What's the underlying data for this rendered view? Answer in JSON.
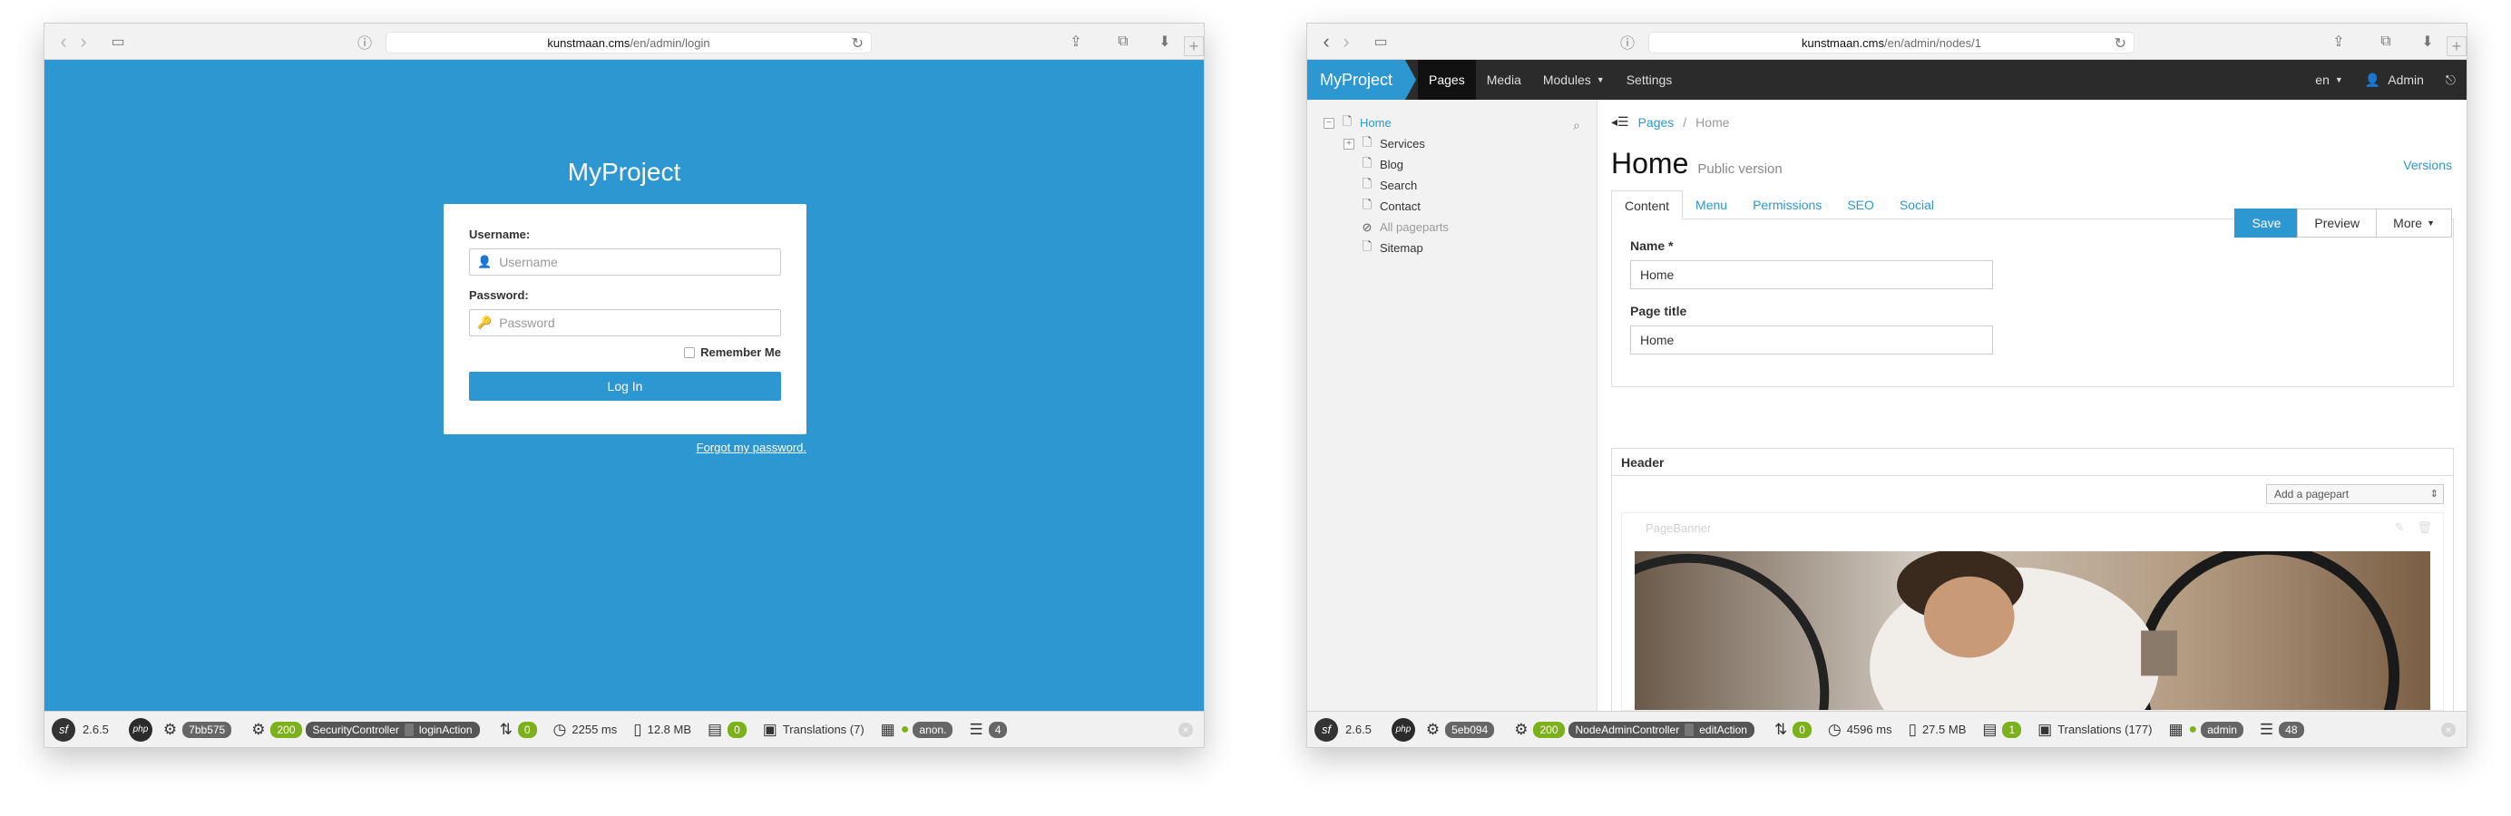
{
  "left": {
    "browser": {
      "url_host": "kunstmaan.cms",
      "url_path": "/en/admin/login"
    },
    "app_title": "MyProject",
    "form": {
      "username_label": "Username:",
      "username_placeholder": "Username",
      "password_label": "Password:",
      "password_placeholder": "Password",
      "remember_label": "Remember Me",
      "login_button": "Log In",
      "forgot_link": "Forgot my password."
    },
    "profiler": {
      "version": "2.6.5",
      "token": "7bb575",
      "status": "200",
      "controller": "SecurityController",
      "action": "loginAction",
      "routing_count": "0",
      "time": "2255 ms",
      "memory": "12.8 MB",
      "forms_count": "0",
      "translations": "Translations (7)",
      "user": "anon.",
      "logs_count": "4"
    }
  },
  "right": {
    "browser": {
      "url_host": "kunstmaan.cms",
      "url_path": "/en/admin/nodes/1"
    },
    "nav": {
      "brand": "MyProject",
      "items": [
        "Pages",
        "Media",
        "Modules",
        "Settings"
      ],
      "lang": "en",
      "user": "Admin"
    },
    "tree": {
      "items": [
        {
          "label": "Home"
        },
        {
          "label": "Services"
        },
        {
          "label": "Blog"
        },
        {
          "label": "Search"
        },
        {
          "label": "Contact"
        },
        {
          "label": "All pageparts"
        },
        {
          "label": "Sitemap"
        }
      ]
    },
    "breadcrumb": [
      "Pages",
      "/",
      "Home"
    ],
    "page": {
      "title": "Home",
      "subtitle": "Public version",
      "versions_link": "Versions"
    },
    "tabs": [
      "Content",
      "Menu",
      "Permissions",
      "SEO",
      "Social"
    ],
    "actions": {
      "save": "Save",
      "preview": "Preview",
      "more": "More"
    },
    "fields": {
      "name_label": "Name *",
      "name_value": "Home",
      "page_title_label": "Page title",
      "page_title_value": "Home"
    },
    "section": {
      "title": "Header",
      "add_pagepart": "Add a pagepart",
      "pagepart_name": "PageBanner"
    },
    "profiler": {
      "version": "2.6.5",
      "token": "5eb094",
      "status": "200",
      "controller": "NodeAdminController",
      "action": "editAction",
      "routing_count": "0",
      "time": "4596 ms",
      "memory": "27.5 MB",
      "forms_count": "1",
      "translations": "Translations (177)",
      "user": "admin",
      "logs_count": "48"
    }
  }
}
